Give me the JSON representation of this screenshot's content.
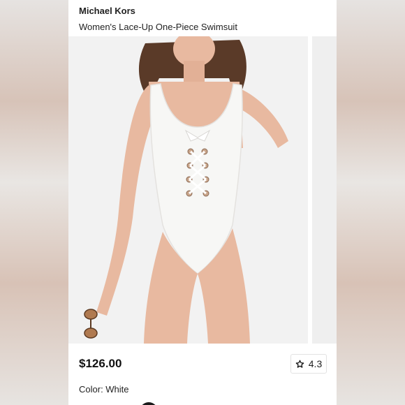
{
  "product": {
    "brand": "Michael Kors",
    "name": "Women's Lace-Up One-Piece Swimsuit",
    "price": "$126.00",
    "rating": "4.3",
    "color_label": "Color: White"
  },
  "icons": {
    "rating": "star-outline-icon"
  },
  "colors": {
    "card_background": "#ffffff",
    "text_primary": "#111111",
    "swimsuit": "#f7f7f5",
    "skin": "#e8b9a0",
    "hair": "#5a3a28"
  }
}
